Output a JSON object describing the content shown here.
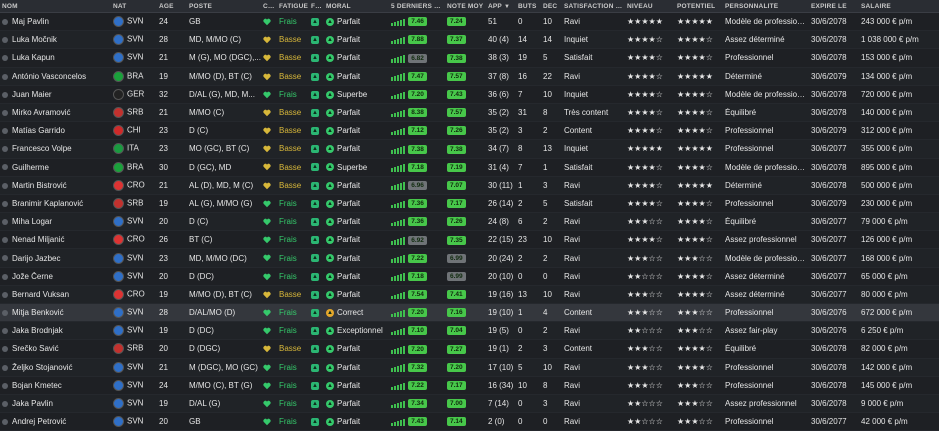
{
  "headers": {
    "name": "NOM",
    "nat": "NAT",
    "age": "ÂGE",
    "pos": "POSTE",
    "cph": "CPH",
    "fat": "FATIGUE",
    "fph": "FPH",
    "mor": "MORAL",
    "last": "5 DERNIERS M...",
    "note": "NOTE MOY",
    "app": "APP",
    "but": "BUTS",
    "dec": "DÉC",
    "sat": "SATISFACTION T...",
    "niv": "NIVEAU",
    "pot": "POTENTIEL",
    "pers": "PERSONNALITÉ",
    "exp": "EXPIRE LE",
    "sal": "SALAIRE"
  },
  "colors": {
    "green": "#35c96b",
    "yellow": "#d7b73a",
    "pill_green": "#47c74a",
    "pill_grey": "#6f7377"
  },
  "rows": [
    {
      "name": "Maj Pavlin",
      "nat": "SVN",
      "age": "24",
      "pos": "GB",
      "fat": "Frais",
      "mor": "Parfait",
      "last": "7.46",
      "note": "7.24",
      "app": "51",
      "but": "0",
      "dec": "10",
      "sat": "Ravi",
      "niv": "★★★★★",
      "pot": "★★★★★",
      "pers": "Modèle de professionn...",
      "exp": "30/6/2078",
      "sal": "243 000 € p/m"
    },
    {
      "name": "Luka Močnik",
      "nat": "SVN",
      "age": "28",
      "pos": "MD, M/MO (C)",
      "fat": "Basse",
      "mor": "Parfait",
      "last": "7.88",
      "note": "7.37",
      "app": "40 (4)",
      "but": "14",
      "dec": "14",
      "sat": "Inquiet",
      "niv": "★★★★☆",
      "pot": "★★★★☆",
      "pers": "Assez déterminé",
      "exp": "30/6/2078",
      "sal": "1 038 000 € p/m"
    },
    {
      "name": "Luka Kapun",
      "nat": "SVN",
      "age": "21",
      "pos": "M (G), MO (DGC),...",
      "fat": "Basse",
      "mor": "Parfait",
      "last": "6.82",
      "note": "7.38",
      "app": "38 (3)",
      "but": "19",
      "dec": "5",
      "sat": "Satisfait",
      "niv": "★★★★☆",
      "pot": "★★★★☆",
      "pers": "Professionnel",
      "exp": "30/6/2078",
      "sal": "153 000 € p/m"
    },
    {
      "name": "António Vasconcelos",
      "nat": "BRA",
      "age": "19",
      "pos": "M/MO (D), BT (C)",
      "fat": "Basse",
      "mor": "Parfait",
      "last": "7.47",
      "note": "7.57",
      "app": "37 (8)",
      "but": "16",
      "dec": "22",
      "sat": "Ravi",
      "niv": "★★★★☆",
      "pot": "★★★★★",
      "pers": "Déterminé",
      "exp": "30/6/2079",
      "sal": "134 000 € p/m"
    },
    {
      "name": "Juan Maier",
      "nat": "GER",
      "age": "32",
      "pos": "D/AL (G), MD, M...",
      "fat": "Frais",
      "mor": "Superbe",
      "last": "7.20",
      "note": "7.43",
      "app": "36 (6)",
      "but": "7",
      "dec": "10",
      "sat": "Inquiet",
      "niv": "★★★★☆",
      "pot": "★★★★☆",
      "pers": "Modèle de professionn...",
      "exp": "30/6/2078",
      "sal": "720 000 € p/m"
    },
    {
      "name": "Mirko Avramović",
      "nat": "SRB",
      "age": "21",
      "pos": "M/MO (C)",
      "fat": "Basse",
      "mor": "Parfait",
      "last": "8.38",
      "note": "7.57",
      "app": "35 (2)",
      "but": "31",
      "dec": "8",
      "sat": "Très content",
      "niv": "★★★★☆",
      "pot": "★★★★☆",
      "pers": "Équilibré",
      "exp": "30/6/2078",
      "sal": "140 000 € p/m"
    },
    {
      "name": "Matías Garrido",
      "nat": "CHI",
      "age": "23",
      "pos": "D (C)",
      "fat": "Basse",
      "mor": "Parfait",
      "last": "7.12",
      "note": "7.26",
      "app": "35 (2)",
      "but": "3",
      "dec": "2",
      "sat": "Content",
      "niv": "★★★★☆",
      "pot": "★★★★☆",
      "pers": "Professionnel",
      "exp": "30/6/2079",
      "sal": "312 000 € p/m"
    },
    {
      "name": "Francesco Volpe",
      "nat": "ITA",
      "age": "23",
      "pos": "MO (GC), BT (C)",
      "fat": "Basse",
      "mor": "Parfait",
      "last": "7.38",
      "note": "7.38",
      "app": "34 (7)",
      "but": "8",
      "dec": "13",
      "sat": "Inquiet",
      "niv": "★★★★★",
      "pot": "★★★★★",
      "pers": "Professionnel",
      "exp": "30/6/2077",
      "sal": "355 000 € p/m"
    },
    {
      "name": "Guilherme",
      "nat": "BRA",
      "age": "30",
      "pos": "D (GC), MD",
      "fat": "Basse",
      "mor": "Superbe",
      "last": "7.18",
      "note": "7.19",
      "app": "31 (4)",
      "but": "7",
      "dec": "1",
      "sat": "Satisfait",
      "niv": "★★★★☆",
      "pot": "★★★★☆",
      "pers": "Modèle de professionn...",
      "exp": "30/6/2078",
      "sal": "895 000 € p/m"
    },
    {
      "name": "Martin Bistrović",
      "nat": "CRO",
      "age": "21",
      "pos": "AL (D), MD, M (C)",
      "fat": "Basse",
      "mor": "Parfait",
      "last": "6.96",
      "note": "7.07",
      "app": "30 (11)",
      "but": "1",
      "dec": "3",
      "sat": "Ravi",
      "niv": "★★★★☆",
      "pot": "★★★★★",
      "pers": "Déterminé",
      "exp": "30/6/2078",
      "sal": "500 000 € p/m"
    },
    {
      "name": "Branimir Kaplanović",
      "nat": "SRB",
      "age": "19",
      "pos": "AL (G), M/MO (G)",
      "fat": "Frais",
      "mor": "Parfait",
      "last": "7.36",
      "note": "7.17",
      "app": "26 (14)",
      "but": "2",
      "dec": "5",
      "sat": "Satisfait",
      "niv": "★★★★☆",
      "pot": "★★★★☆",
      "pers": "Professionnel",
      "exp": "30/6/2079",
      "sal": "230 000 € p/m"
    },
    {
      "name": "Miha Logar",
      "nat": "SVN",
      "age": "20",
      "pos": "D (C)",
      "fat": "Frais",
      "mor": "Parfait",
      "last": "7.36",
      "note": "7.26",
      "app": "24 (8)",
      "but": "6",
      "dec": "2",
      "sat": "Ravi",
      "niv": "★★★☆☆",
      "pot": "★★★★☆",
      "pers": "Équilibré",
      "exp": "30/6/2077",
      "sal": "79 000 € p/m"
    },
    {
      "name": "Nenad Miljanić",
      "nat": "CRO",
      "age": "26",
      "pos": "BT (C)",
      "fat": "Frais",
      "mor": "Parfait",
      "last": "6.92",
      "note": "7.35",
      "app": "22 (15)",
      "but": "23",
      "dec": "10",
      "sat": "Ravi",
      "niv": "★★★★☆",
      "pot": "★★★★☆",
      "pers": "Assez professionnel",
      "exp": "30/6/2077",
      "sal": "126 000 € p/m"
    },
    {
      "name": "Darijo Jazbec",
      "nat": "SVN",
      "age": "23",
      "pos": "MD, M/MO (DC)",
      "fat": "Frais",
      "mor": "Parfait",
      "last": "7.22",
      "note": "6.99",
      "app": "20 (24)",
      "but": "2",
      "dec": "2",
      "sat": "Ravi",
      "niv": "★★★☆☆",
      "pot": "★★★☆☆",
      "pers": "Modèle de professionn...",
      "exp": "30/6/2077",
      "sal": "168 000 € p/m"
    },
    {
      "name": "Jože Černe",
      "nat": "SVN",
      "age": "20",
      "pos": "D (DC)",
      "fat": "Frais",
      "mor": "Parfait",
      "last": "7.18",
      "note": "6.99",
      "app": "20 (10)",
      "but": "0",
      "dec": "0",
      "sat": "Ravi",
      "niv": "★★☆☆☆",
      "pot": "★★★★☆",
      "pers": "Assez déterminé",
      "exp": "30/6/2077",
      "sal": "65 000 € p/m"
    },
    {
      "name": "Bernard Vuksan",
      "nat": "CRO",
      "age": "19",
      "pos": "M/MO (D), BT (C)",
      "fat": "Basse",
      "mor": "Parfait",
      "last": "7.54",
      "note": "7.41",
      "app": "19 (16)",
      "but": "13",
      "dec": "10",
      "sat": "Ravi",
      "niv": "★★★☆☆",
      "pot": "★★★★☆",
      "pers": "Assez déterminé",
      "exp": "30/6/2077",
      "sal": "80 000 € p/m"
    },
    {
      "name": "Mitja Benković",
      "nat": "SVN",
      "age": "28",
      "pos": "D/AL/MO (D)",
      "fat": "Frais",
      "mor": "Correct",
      "last": "7.20",
      "note": "7.16",
      "app": "19 (10)",
      "but": "1",
      "dec": "4",
      "sat": "Content",
      "niv": "★★★☆☆",
      "pot": "★★★☆☆",
      "pers": "Professionnel",
      "exp": "30/6/2076",
      "sal": "672 000 € p/m"
    },
    {
      "name": "Jaka Brodnjak",
      "nat": "SVN",
      "age": "19",
      "pos": "D (DC)",
      "fat": "Frais",
      "mor": "Exceptionnel",
      "last": "7.10",
      "note": "7.04",
      "app": "19 (5)",
      "but": "0",
      "dec": "2",
      "sat": "Ravi",
      "niv": "★★☆☆☆",
      "pot": "★★★☆☆",
      "pers": "Assez fair-play",
      "exp": "30/6/2076",
      "sal": "6 250 € p/m"
    },
    {
      "name": "Srečko Savić",
      "nat": "SRB",
      "age": "20",
      "pos": "D (DGC)",
      "fat": "Basse",
      "mor": "Parfait",
      "last": "7.20",
      "note": "7.27",
      "app": "19 (1)",
      "but": "2",
      "dec": "3",
      "sat": "Content",
      "niv": "★★★☆☆",
      "pot": "★★★★☆",
      "pers": "Équilibré",
      "exp": "30/6/2078",
      "sal": "82 000 € p/m"
    },
    {
      "name": "Željko Stojanović",
      "nat": "SVN",
      "age": "21",
      "pos": "M (DGC), MO (GC)",
      "fat": "Frais",
      "mor": "Parfait",
      "last": "7.32",
      "note": "7.20",
      "app": "17 (10)",
      "but": "5",
      "dec": "10",
      "sat": "Ravi",
      "niv": "★★★☆☆",
      "pot": "★★★★☆",
      "pers": "Professionnel",
      "exp": "30/6/2078",
      "sal": "142 000 € p/m"
    },
    {
      "name": "Bojan Kmetec",
      "nat": "SVN",
      "age": "24",
      "pos": "M/MO (C), BT (G)",
      "fat": "Frais",
      "mor": "Parfait",
      "last": "7.22",
      "note": "7.17",
      "app": "16 (34)",
      "but": "10",
      "dec": "8",
      "sat": "Ravi",
      "niv": "★★★☆☆",
      "pot": "★★★☆☆",
      "pers": "Professionnel",
      "exp": "30/6/2078",
      "sal": "145 000 € p/m"
    },
    {
      "name": "Jaka Pavlin",
      "nat": "SVN",
      "age": "19",
      "pos": "D/AL (G)",
      "fat": "Frais",
      "mor": "Parfait",
      "last": "7.34",
      "note": "7.00",
      "app": "7 (14)",
      "but": "0",
      "dec": "3",
      "sat": "Ravi",
      "niv": "★★☆☆☆",
      "pot": "★★★☆☆",
      "pers": "Assez professionnel",
      "exp": "30/6/2078",
      "sal": "9 000 € p/m"
    },
    {
      "name": "Andrej Petrović",
      "nat": "SVN",
      "age": "20",
      "pos": "GB",
      "fat": "Frais",
      "mor": "Parfait",
      "last": "7.43",
      "note": "7.14",
      "app": "2 (0)",
      "but": "0",
      "dec": "0",
      "sat": "Ravi",
      "niv": "★★☆☆☆",
      "pot": "★★★☆☆",
      "pers": "Professionnel",
      "exp": "30/6/2077",
      "sal": "42 000 € p/m"
    }
  ]
}
